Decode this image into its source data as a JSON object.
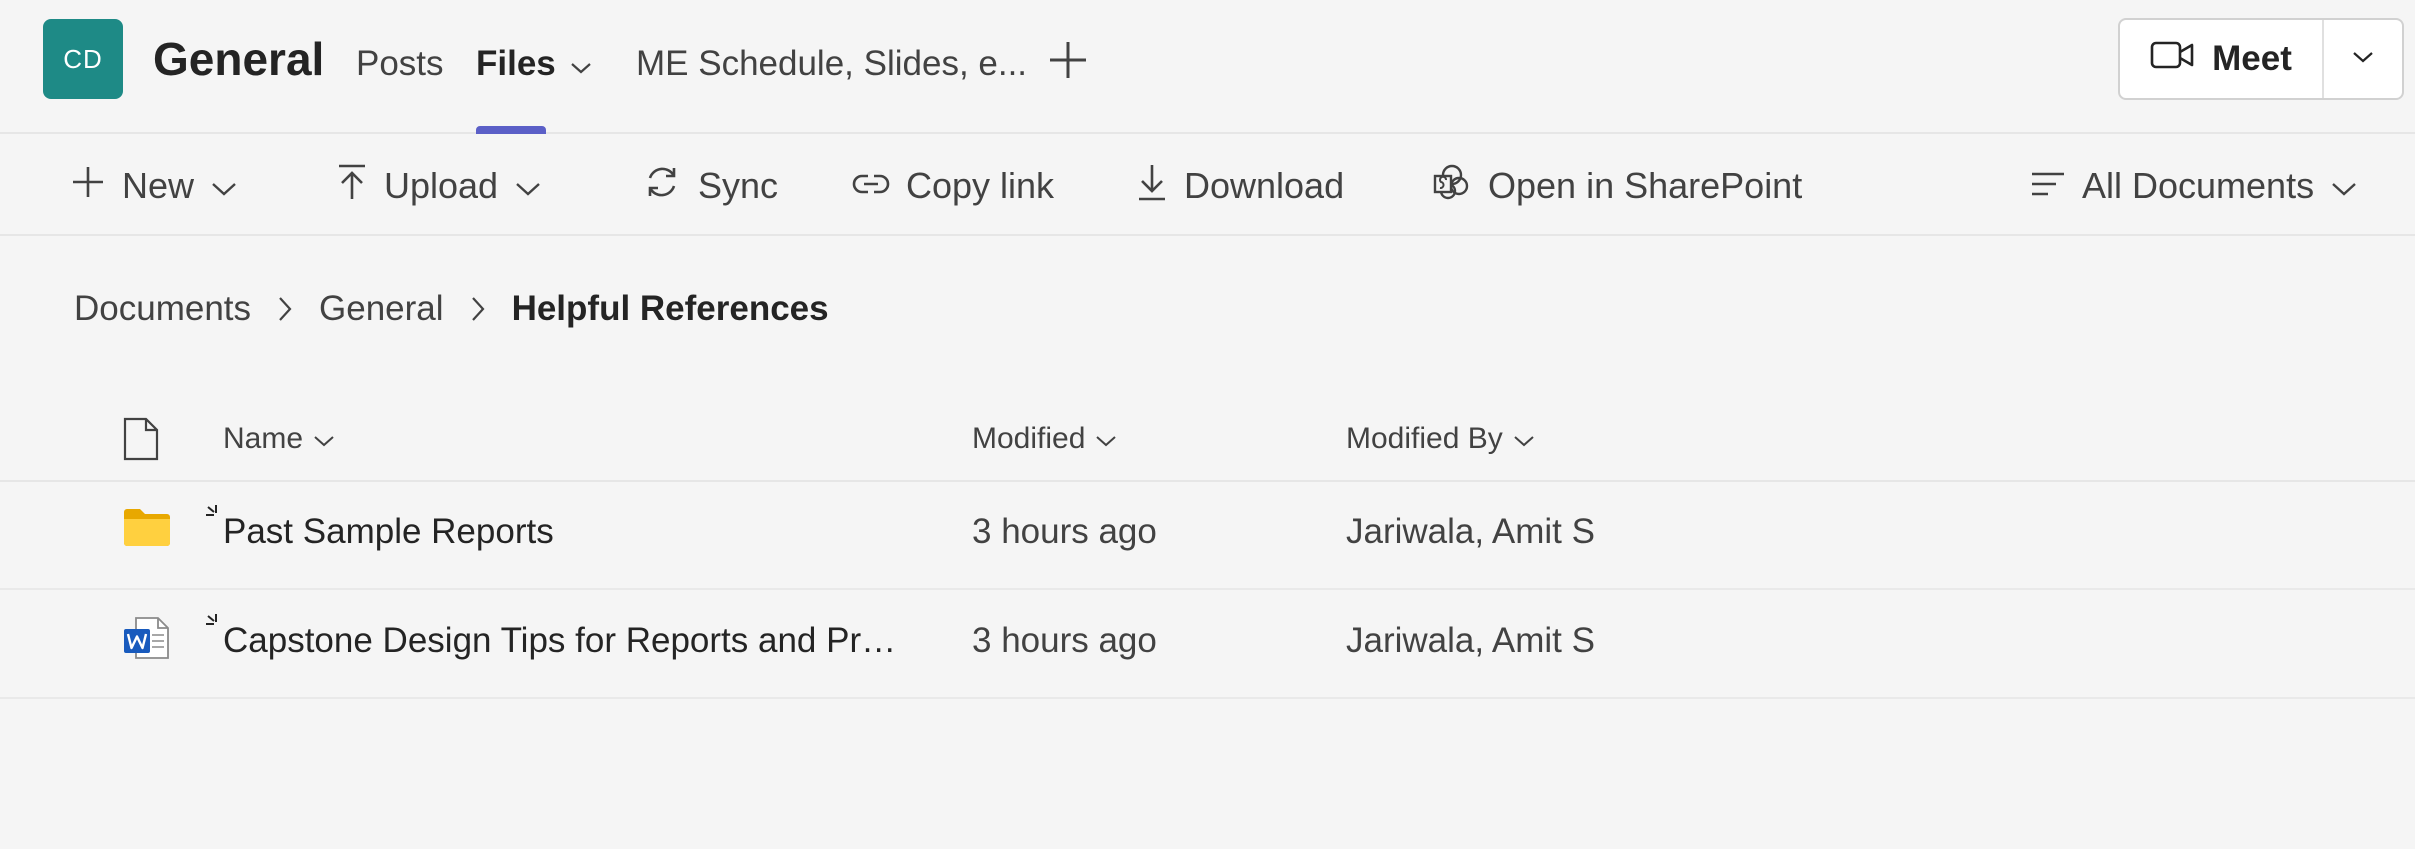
{
  "header": {
    "avatar_initials": "CD",
    "avatar_color": "#1e8a86",
    "channel_name": "General",
    "tabs": [
      {
        "label": "Posts"
      },
      {
        "label": "Files"
      },
      {
        "label": "ME Schedule, Slides, e..."
      }
    ],
    "active_tab_color": "#5b5fc7",
    "add_tab_icon": "plus-icon",
    "meet_label": "Meet"
  },
  "toolbar": {
    "new_label": "New",
    "upload_label": "Upload",
    "sync_label": "Sync",
    "copy_link_label": "Copy link",
    "download_label": "Download",
    "sharepoint_label": "Open in SharePoint",
    "view_label": "All Documents"
  },
  "breadcrumb": {
    "items": [
      "Documents",
      "General"
    ],
    "current": "Helpful References"
  },
  "table": {
    "columns": {
      "name": "Name",
      "modified": "Modified",
      "modified_by": "Modified By"
    },
    "rows": [
      {
        "type": "folder",
        "icon": "folder-icon",
        "name": "Past Sample Reports",
        "modified": "3 hours ago",
        "modified_by": "Jariwala, Amit S"
      },
      {
        "type": "word",
        "icon": "word-document-icon",
        "name": "Capstone Design Tips for Reports and Pres...",
        "modified": "3 hours ago",
        "modified_by": "Jariwala, Amit S"
      }
    ]
  }
}
